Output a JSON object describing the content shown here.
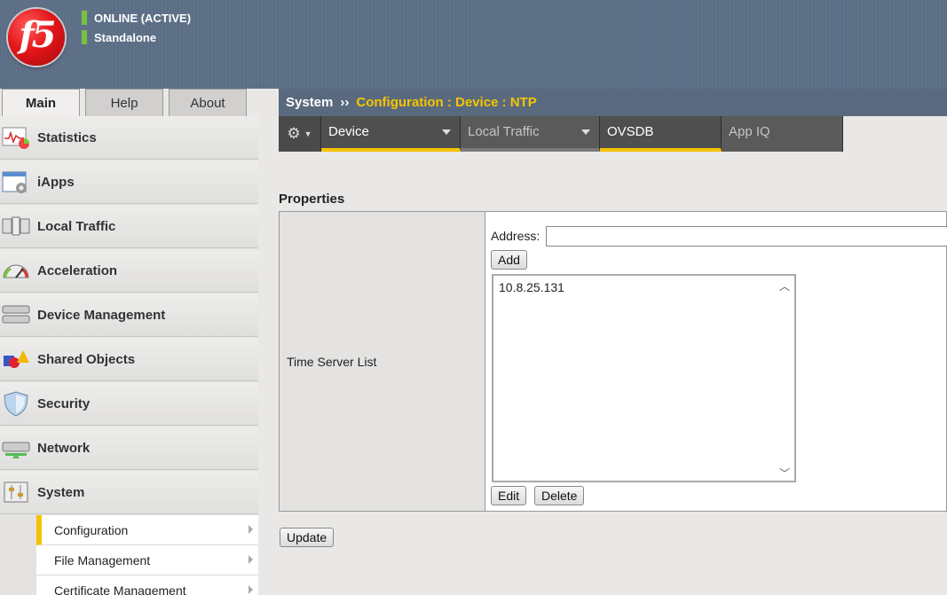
{
  "header": {
    "logo_text": "f5",
    "status": "ONLINE (ACTIVE)",
    "mode": "Standalone"
  },
  "tabs": [
    {
      "label": "Main"
    },
    {
      "label": "Help"
    },
    {
      "label": "About"
    }
  ],
  "sidebar": {
    "items": [
      {
        "label": "Statistics",
        "icon": "statistics-icon"
      },
      {
        "label": "iApps",
        "icon": "iapps-icon"
      },
      {
        "label": "Local Traffic",
        "icon": "local-traffic-icon"
      },
      {
        "label": "Acceleration",
        "icon": "acceleration-icon"
      },
      {
        "label": "Device Management",
        "icon": "device-management-icon"
      },
      {
        "label": "Shared Objects",
        "icon": "shared-objects-icon"
      },
      {
        "label": "Security",
        "icon": "security-icon"
      },
      {
        "label": "Network",
        "icon": "network-icon"
      },
      {
        "label": "System",
        "icon": "system-icon"
      }
    ],
    "subitems": [
      {
        "label": "Configuration"
      },
      {
        "label": "File Management"
      },
      {
        "label": "Certificate Management"
      }
    ]
  },
  "breadcrumb": {
    "root": "System",
    "separator": "››",
    "path": "Configuration : Device : NTP"
  },
  "menubar": {
    "gear": "⚙",
    "items": [
      {
        "label": "Device"
      },
      {
        "label": "Local Traffic"
      },
      {
        "label": "OVSDB"
      },
      {
        "label": "App IQ"
      }
    ]
  },
  "properties": {
    "title": "Properties",
    "row_label": "Time Server List",
    "address_label": "Address:",
    "address_value": "",
    "add_button": "Add",
    "servers": [
      "10.8.25.131"
    ],
    "edit_button": "Edit",
    "delete_button": "Delete"
  },
  "update_button": "Update",
  "colors": {
    "accent": "#f5c400",
    "header": "#5d6f86",
    "status_green": "#79c142"
  }
}
